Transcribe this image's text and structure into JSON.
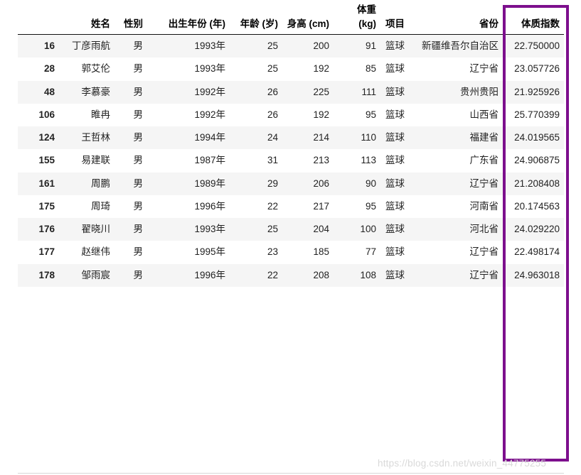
{
  "table": {
    "columns": [
      {
        "key": "index",
        "label": ""
      },
      {
        "key": "name",
        "label": "姓名"
      },
      {
        "key": "sex",
        "label": "性别"
      },
      {
        "key": "birth",
        "label": "出生年份\n(年)"
      },
      {
        "key": "age",
        "label": "年龄\n(岁)"
      },
      {
        "key": "height",
        "label": "身高\n(cm)"
      },
      {
        "key": "weight",
        "label": "体重\n(kg)"
      },
      {
        "key": "sport",
        "label": "项目"
      },
      {
        "key": "prov",
        "label": "省份"
      },
      {
        "key": "bmi",
        "label": "体质指数"
      }
    ],
    "rows": [
      {
        "index": "16",
        "name": "丁彦雨航",
        "sex": "男",
        "birth": "1993年",
        "age": "25",
        "height": "200",
        "weight": "91",
        "sport": "篮球",
        "prov": "新疆维吾尔自治区",
        "bmi": "22.750000"
      },
      {
        "index": "28",
        "name": "郭艾伦",
        "sex": "男",
        "birth": "1993年",
        "age": "25",
        "height": "192",
        "weight": "85",
        "sport": "篮球",
        "prov": "辽宁省",
        "bmi": "23.057726"
      },
      {
        "index": "48",
        "name": "李慕豪",
        "sex": "男",
        "birth": "1992年",
        "age": "26",
        "height": "225",
        "weight": "111",
        "sport": "篮球",
        "prov": "贵州贵阳",
        "bmi": "21.925926"
      },
      {
        "index": "106",
        "name": "睢冉",
        "sex": "男",
        "birth": "1992年",
        "age": "26",
        "height": "192",
        "weight": "95",
        "sport": "篮球",
        "prov": "山西省",
        "bmi": "25.770399"
      },
      {
        "index": "124",
        "name": "王哲林",
        "sex": "男",
        "birth": "1994年",
        "age": "24",
        "height": "214",
        "weight": "110",
        "sport": "篮球",
        "prov": "福建省",
        "bmi": "24.019565"
      },
      {
        "index": "155",
        "name": "易建联",
        "sex": "男",
        "birth": "1987年",
        "age": "31",
        "height": "213",
        "weight": "113",
        "sport": "篮球",
        "prov": "广东省",
        "bmi": "24.906875"
      },
      {
        "index": "161",
        "name": "周鹏",
        "sex": "男",
        "birth": "1989年",
        "age": "29",
        "height": "206",
        "weight": "90",
        "sport": "篮球",
        "prov": "辽宁省",
        "bmi": "21.208408"
      },
      {
        "index": "175",
        "name": "周琦",
        "sex": "男",
        "birth": "1996年",
        "age": "22",
        "height": "217",
        "weight": "95",
        "sport": "篮球",
        "prov": "河南省",
        "bmi": "20.174563"
      },
      {
        "index": "176",
        "name": "翟晓川",
        "sex": "男",
        "birth": "1993年",
        "age": "25",
        "height": "204",
        "weight": "100",
        "sport": "篮球",
        "prov": "河北省",
        "bmi": "24.029220"
      },
      {
        "index": "177",
        "name": "赵继伟",
        "sex": "男",
        "birth": "1995年",
        "age": "23",
        "height": "185",
        "weight": "77",
        "sport": "篮球",
        "prov": "辽宁省",
        "bmi": "22.498174"
      },
      {
        "index": "178",
        "name": "邹雨宸",
        "sex": "男",
        "birth": "1996年",
        "age": "22",
        "height": "208",
        "weight": "108",
        "sport": "篮球",
        "prov": "辽宁省",
        "bmi": "24.963018"
      }
    ]
  },
  "annotation": {
    "highlight_color": "#7d0f8d",
    "highlighted_column": "体质指数"
  },
  "watermark": {
    "text": "https://blog.csdn.net/weixin_44775255",
    "color": "#d9d9d9"
  }
}
